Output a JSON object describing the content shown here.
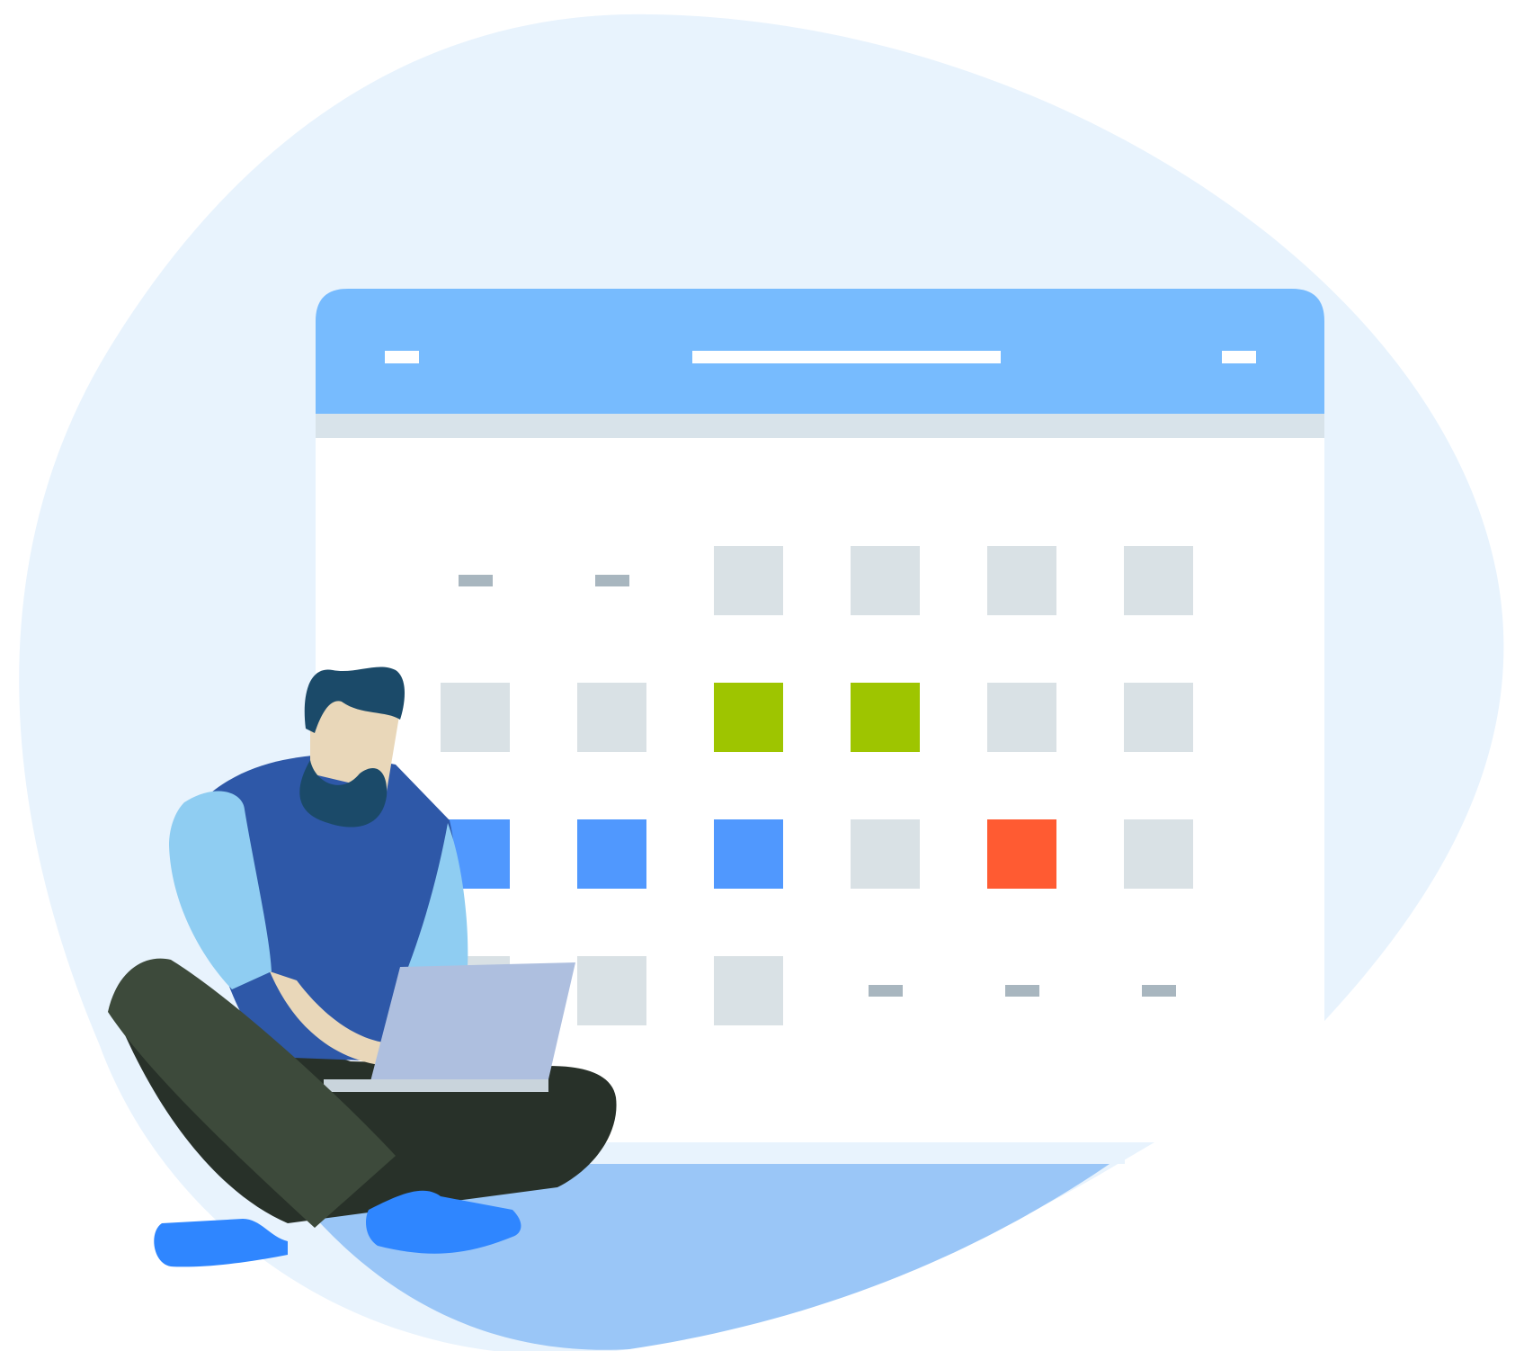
{
  "colors": {
    "blob": "#e8f3fd",
    "floor": "#9ac6f7",
    "header": "#77bbfe",
    "header_lines": "#ffffff",
    "subheader": "#d8e3ea",
    "panel": "#ffffff",
    "cell_empty": "#d9e1e5",
    "placeholder_dash": "#a8b6bf",
    "green": "#9ec500",
    "blue": "#5098fe",
    "orange": "#ff5b32",
    "skin": "#e9d7b9",
    "hair": "#1b4a69",
    "vest": "#2e58a8",
    "sleeve": "#8fcdf2",
    "pants_light": "#3d4a3b",
    "pants_dark": "#283129",
    "shoe": "#2f86ff",
    "laptop": "#aebfdf"
  },
  "calendar": {
    "rows": [
      [
        "dash",
        "dash",
        "empty",
        "empty",
        "empty",
        "empty"
      ],
      [
        "empty",
        "empty",
        "green",
        "green",
        "empty",
        "empty"
      ],
      [
        "blue",
        "blue",
        "blue",
        "empty",
        "orange",
        "empty"
      ],
      [
        "empty",
        "empty",
        "empty",
        "dash",
        "dash",
        "dash"
      ]
    ]
  }
}
